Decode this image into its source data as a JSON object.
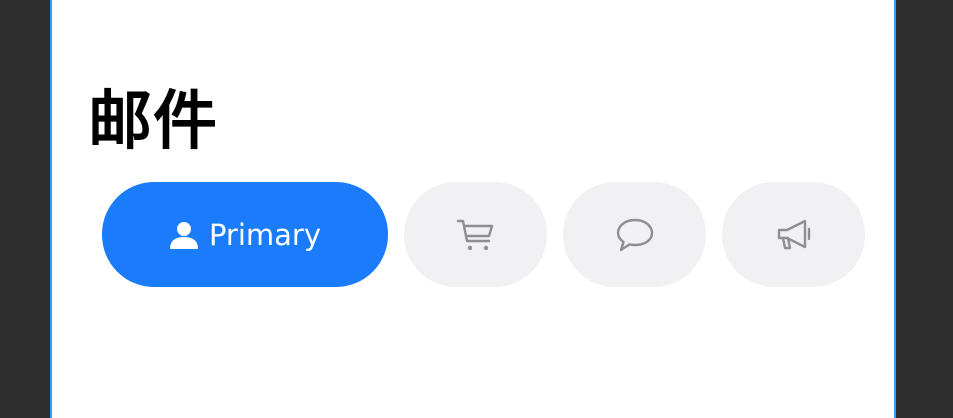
{
  "page": {
    "title": "邮件"
  },
  "tabs": [
    {
      "id": "primary",
      "label": "Primary",
      "icon": "person-icon",
      "active": true
    },
    {
      "id": "shopping",
      "label": "",
      "icon": "shopping-cart-icon",
      "active": false
    },
    {
      "id": "chat",
      "label": "",
      "icon": "chat-bubble-icon",
      "active": false
    },
    {
      "id": "promotions",
      "label": "",
      "icon": "megaphone-icon",
      "active": false
    }
  ],
  "colors": {
    "accent": "#1a7cfb",
    "inactive_tab_bg": "#f1f1f4",
    "inactive_icon": "#8e8e93",
    "frame_border": "#3a9bf0"
  }
}
